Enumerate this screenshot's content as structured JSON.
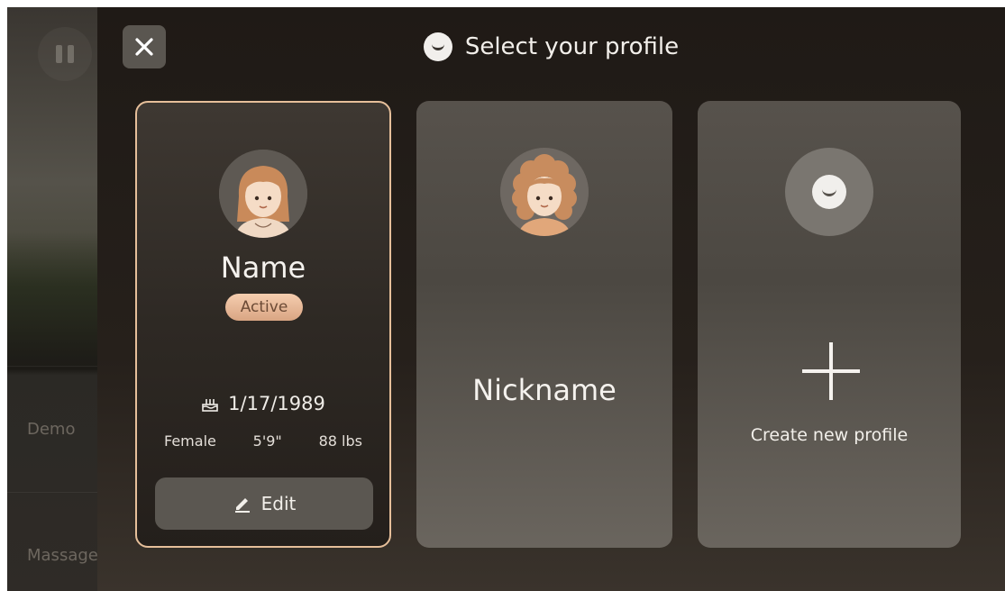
{
  "background": {
    "rows": [
      "Demo",
      "Massage"
    ]
  },
  "header": {
    "title": "Select your profile",
    "icon": "smile-icon"
  },
  "close_icon": "close-icon",
  "profiles": [
    {
      "name": "Name",
      "status": "Active",
      "birthday": "1/17/1989",
      "gender": "Female",
      "height": "5'9\"",
      "weight": "88 lbs",
      "edit_label": "Edit"
    },
    {
      "name": "Nickname"
    }
  ],
  "create": {
    "label": "Create new profile"
  },
  "colors": {
    "active_border": "#e6bf9a",
    "badge": "#e8b898"
  }
}
